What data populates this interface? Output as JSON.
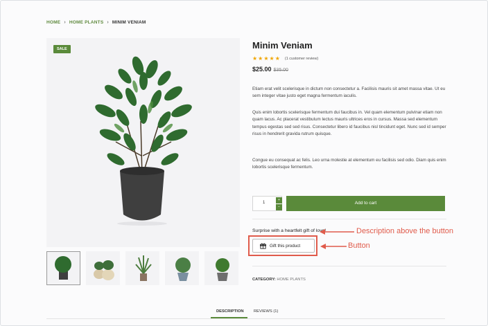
{
  "breadcrumb": {
    "home": "HOME",
    "category": "HOME PLANTS",
    "current": "MINIM VENIAM",
    "separator": "›"
  },
  "badge": {
    "sale": "SALE"
  },
  "product": {
    "title": "Minim Veniam",
    "stars": "★★★★★",
    "review_count": "(1 customer review)",
    "price_current": "$25.00",
    "price_old": "$35.00",
    "description": [
      "Etiam erat velit scelerisque in dictum non consectetur a. Facilisis mauris sit amet massa vitae. Ut eu sem integer vitae justo eget magna fermentum iaculis.",
      "Quis enim lobortis scelerisque fermentum dui faucibus in. Vel quam elementum pulvinar etiam non quam lacus. Ac placerat vestibulum lectus mauris ultrices eros in cursus. Massa sed elementum tempus egestas sed sed risus. Consectetur libero id faucibus nisl tincidunt eget. Nunc sed id semper risus in hendrerit gravida rutrum quisque.",
      "Congue eu consequat ac felis. Leo urna molestie at elementum eu facilisis sed odio. Diam quis enim lobortis scelerisque fermentum."
    ]
  },
  "cart": {
    "quantity": "1",
    "plus": "+",
    "minus": "−",
    "add_label": "Add to cart"
  },
  "gift": {
    "description": "Surprise with a heartfelt gift of love!",
    "button_label": "Gift this product"
  },
  "annotations": {
    "description": "Description above the button",
    "button": "Button"
  },
  "meta": {
    "category_label": "CATEGORY:",
    "category_value": "HOME PLANTS"
  },
  "tabs": [
    {
      "label": "DESCRIPTION"
    },
    {
      "label": "REVIEWS (1)"
    }
  ],
  "colors": {
    "brand_green": "#5a8a3a",
    "annotation_red": "#e05b4b",
    "star": "#f0a500"
  },
  "icons": {
    "gift": "gift-icon",
    "arrow": "arrow-left-icon"
  }
}
